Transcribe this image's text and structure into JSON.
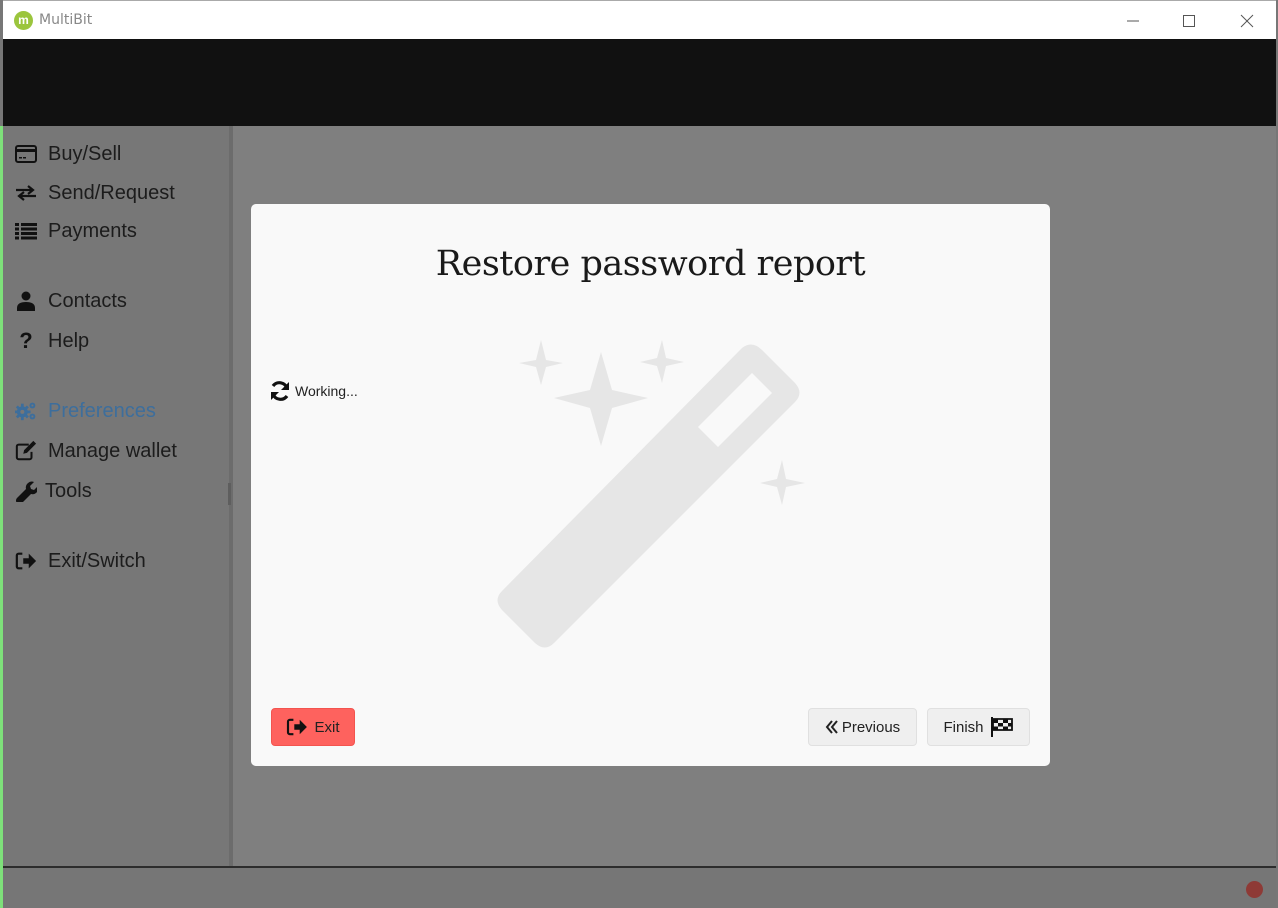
{
  "window": {
    "title": "MultiBit",
    "logo_letter": "m",
    "controls": [
      "minimize",
      "maximize",
      "close"
    ]
  },
  "sidebar": {
    "items": [
      {
        "label": "Buy/Sell",
        "icon": "credit-card-icon"
      },
      {
        "label": "Send/Request",
        "icon": "exchange-icon"
      },
      {
        "label": "Payments",
        "icon": "list-icon"
      },
      {
        "label": "Contacts",
        "icon": "user-icon"
      },
      {
        "label": "Help",
        "icon": "question-icon"
      },
      {
        "label": "Preferences",
        "icon": "gears-icon",
        "active": true
      },
      {
        "label": "Manage wallet",
        "icon": "edit-icon"
      },
      {
        "label": "Tools",
        "icon": "wrench-icon"
      },
      {
        "label": "Exit/Switch",
        "icon": "sign-out-icon"
      }
    ]
  },
  "dialog": {
    "title": "Restore password report",
    "status": {
      "label": "Working...",
      "icon": "refresh-icon"
    },
    "background_icon": "magic-wand-icon",
    "buttons": {
      "exit": "Exit",
      "previous": "Previous",
      "finish": "Finish"
    }
  },
  "statusbar": {
    "indicator_color": "#8e3a36"
  },
  "colors": {
    "exit_button": "#fe625e",
    "active_nav": "#3d6e9c",
    "header": "#111111"
  }
}
